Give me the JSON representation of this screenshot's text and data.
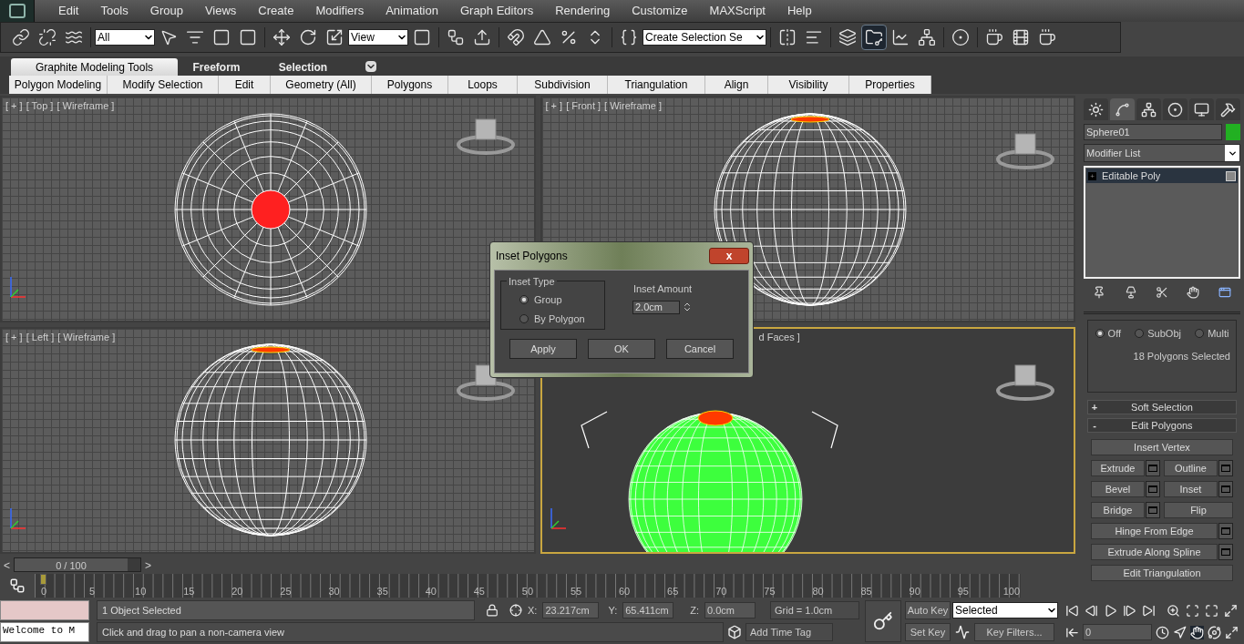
{
  "menu_bar": {
    "items": [
      "Edit",
      "Tools",
      "Group",
      "Views",
      "Create",
      "Modifiers",
      "Animation",
      "Graph Editors",
      "Rendering",
      "Customize",
      "MAXScript",
      "Help"
    ]
  },
  "main_toolbar": {
    "selection_filter": "All",
    "reference_coord": "View",
    "named_selection": "Create Selection Se"
  },
  "ribbon": {
    "tabs": [
      {
        "label": "Graphite Modeling Tools",
        "selected": true
      },
      {
        "label": "Freeform",
        "selected": false
      },
      {
        "label": "Selection",
        "selected": false
      }
    ],
    "panels": [
      "Polygon Modeling",
      "Modify Selection",
      "Edit",
      "Geometry (All)",
      "Polygons",
      "Loops",
      "Subdivision",
      "Triangulation",
      "Align",
      "Visibility",
      "Properties"
    ]
  },
  "viewports": [
    {
      "kind": "top",
      "labels": [
        "[ + ]",
        "[ Top ]",
        "[ Wireframe ]"
      ],
      "active": false
    },
    {
      "kind": "front",
      "labels": [
        "[ + ]",
        "[ Front ]",
        "[ Wireframe ]"
      ],
      "active": false
    },
    {
      "kind": "left",
      "labels": [
        "[ + ]",
        "[ Left ]",
        "[ Wireframe ]"
      ],
      "active": false
    },
    {
      "kind": "perspective",
      "labels": [
        "d Faces ]"
      ],
      "active": true
    }
  ],
  "dialog": {
    "title": "Inset Polygons",
    "close": "x",
    "group_title": "Inset Type",
    "options": [
      {
        "label": "Group",
        "selected": true
      },
      {
        "label": "By Polygon",
        "selected": false
      }
    ],
    "amount_label": "Inset Amount",
    "amount": "2.0cm",
    "buttons": [
      "Apply",
      "OK",
      "Cancel"
    ]
  },
  "command_panel": {
    "tabs": [
      {
        "kind": "create",
        "selected": false
      },
      {
        "kind": "modify",
        "selected": true
      },
      {
        "kind": "hierarchy",
        "selected": false
      },
      {
        "kind": "motion",
        "selected": false
      },
      {
        "kind": "display",
        "selected": false
      },
      {
        "kind": "utilities",
        "selected": false
      }
    ],
    "object_name": "Sphere01",
    "modifier_list": "Modifier List",
    "stack": [
      {
        "label": "Editable Poly",
        "expand": "+",
        "selected": true
      }
    ],
    "preview_options": [
      {
        "label": "Off",
        "selected": true
      },
      {
        "label": "SubObj",
        "selected": false
      },
      {
        "label": "Multi",
        "selected": false
      }
    ],
    "selection_info": "18 Polygons Selected",
    "rollouts": [
      {
        "sign": "+",
        "label": "Soft Selection"
      },
      {
        "sign": "-",
        "label": "Edit Polygons"
      }
    ],
    "button_rows": [
      [
        {
          "label": "Insert Vertex",
          "settings": false
        }
      ],
      [
        {
          "label": "Extrude",
          "settings": true
        },
        {
          "label": "Outline",
          "settings": true
        }
      ],
      [
        {
          "label": "Bevel",
          "settings": true
        },
        {
          "label": "Inset",
          "settings": true
        }
      ],
      [
        {
          "label": "Bridge",
          "settings": true
        },
        {
          "label": "Flip",
          "settings": false
        }
      ],
      [
        {
          "label": "Hinge From Edge",
          "settings": true
        }
      ],
      [
        {
          "label": "Extrude Along Spline",
          "settings": true
        }
      ],
      [
        {
          "label": "Edit Triangulation",
          "settings": false
        }
      ]
    ]
  },
  "time_slider": {
    "prev": "<",
    "label": "0 / 100",
    "next": ">"
  },
  "track_bar": {
    "ticks": [
      "0",
      "5",
      "10",
      "15",
      "20",
      "25",
      "30",
      "35",
      "40",
      "45",
      "50",
      "55",
      "60",
      "65",
      "70",
      "75",
      "80",
      "85",
      "90",
      "95",
      "100"
    ]
  },
  "status": {
    "listener_output": "Welcome to M",
    "prompt": "1 Object Selected",
    "hint": "Click and drag to pan a non-camera view",
    "x_label": "X:",
    "x": "23.217cm",
    "y_label": "Y:",
    "y": "65.411cm",
    "z_label": "Z:",
    "z": "0.0cm",
    "grid": "Grid = 1.0cm",
    "add_time_tag": "Add Time Tag",
    "auto_key": "Auto Key",
    "set_key": "Set Key",
    "key_mode": "Selected",
    "key_filters": "Key Filters...",
    "frame": "0"
  }
}
